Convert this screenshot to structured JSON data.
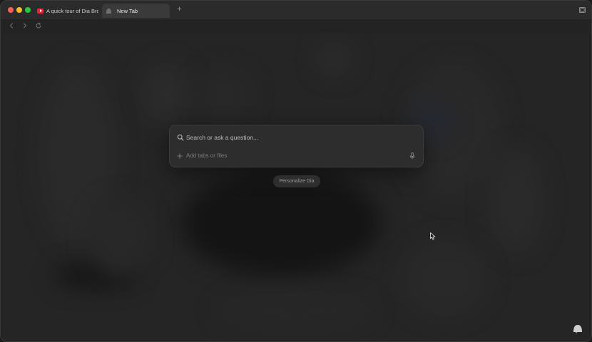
{
  "window": {
    "tabs": [
      {
        "title": "A quick tour of Dia Browser",
        "favicon": "youtube-icon",
        "active": false
      },
      {
        "title": "New Tab",
        "favicon": "dia-icon",
        "active": true
      }
    ],
    "new_tab_label": "+"
  },
  "search": {
    "placeholder": "Search or ask a question...",
    "value": "",
    "add_label": "Add tabs or files"
  },
  "personalize_label": "Personalize Dia",
  "colors": {
    "background": "#232323",
    "card": "#2d2d2d",
    "close": "#ff5f57",
    "minimize": "#febc2e",
    "maximize": "#28c840",
    "youtube": "#e3283b"
  }
}
